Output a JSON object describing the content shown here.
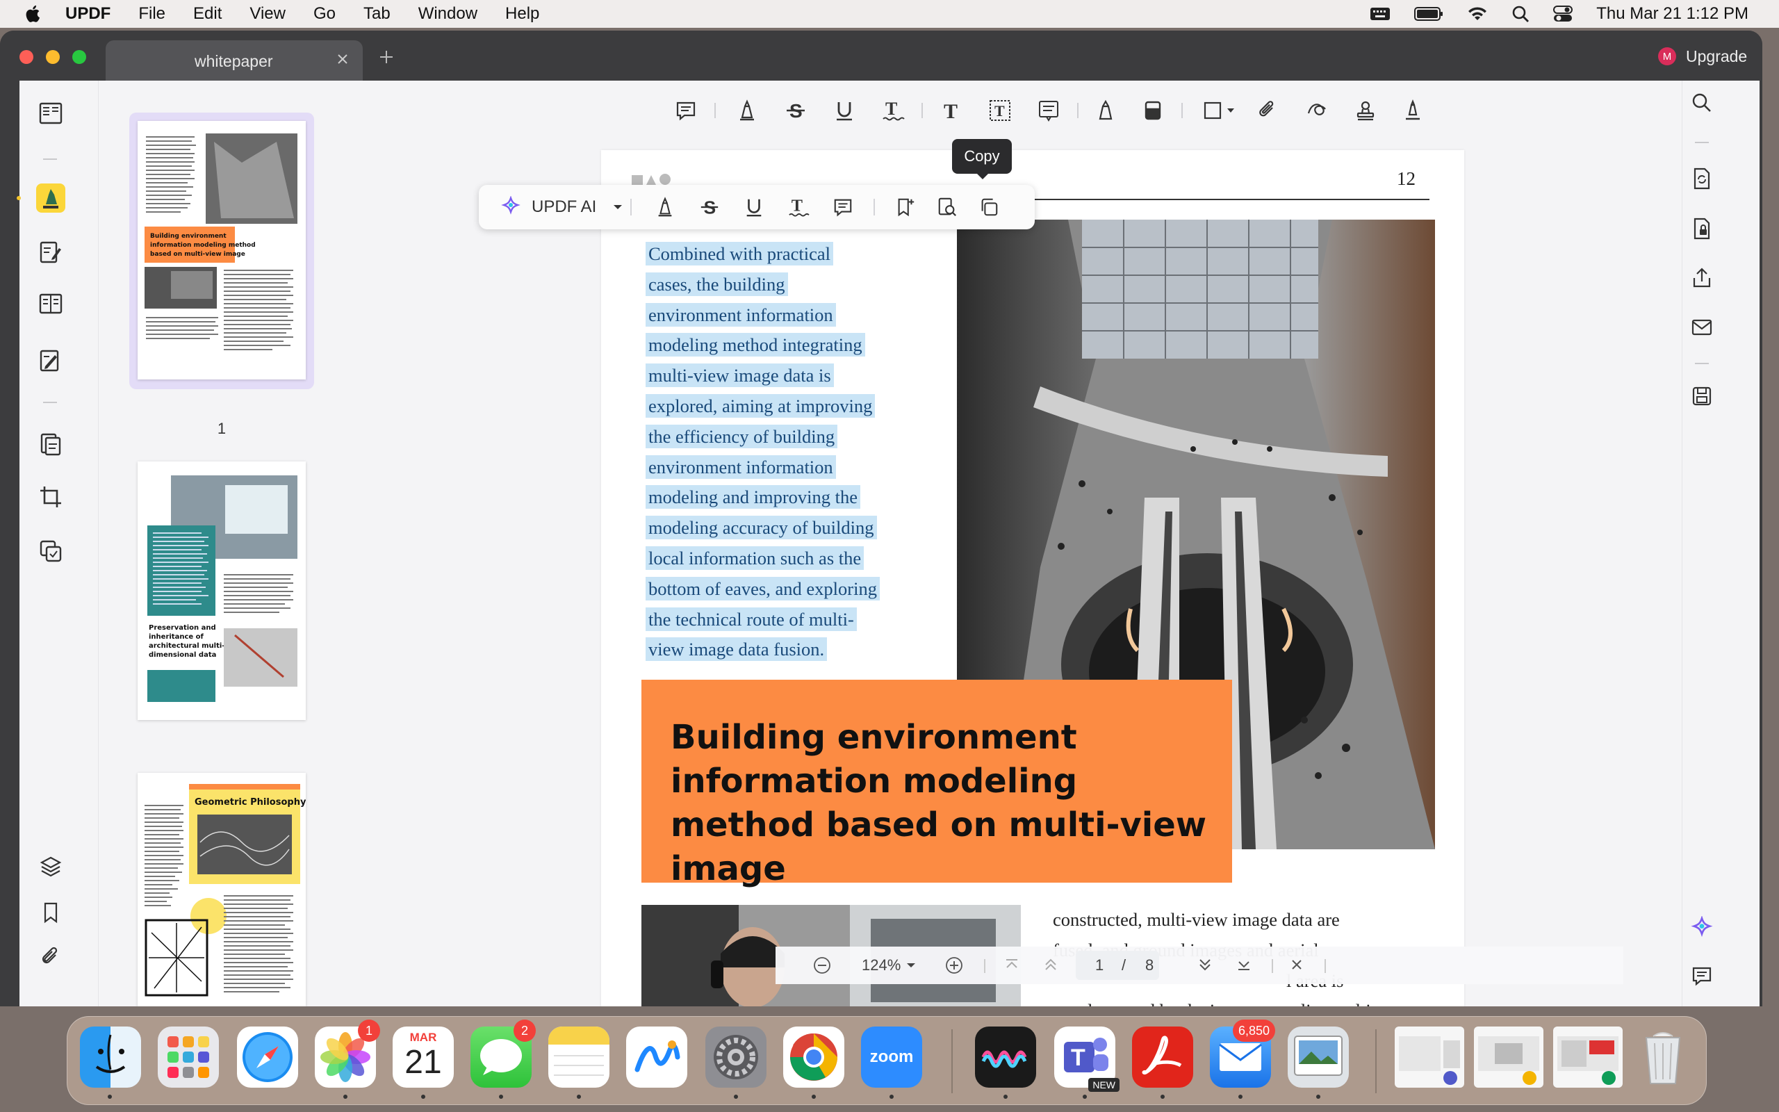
{
  "menubar": {
    "app_name": "UPDF",
    "menus": [
      "File",
      "Edit",
      "View",
      "Go",
      "Tab",
      "Window",
      "Help"
    ],
    "clock": "Thu Mar 21  1:12 PM"
  },
  "window": {
    "tab_title": "whitepaper",
    "upgrade_label": "Upgrade",
    "avatar_letter": "M"
  },
  "thumbnails": {
    "pages": [
      {
        "number": "1",
        "heading": "Building environment information modeling method based on multi-view image"
      },
      {
        "number": "2",
        "heading": "Preservation and inheritance of architectural multi-dimensional data"
      },
      {
        "number": "3",
        "heading": "Geometric Philosophy"
      }
    ]
  },
  "page": {
    "page_number": "12",
    "selected_text": [
      "Combined with practical",
      "cases, the building",
      "environment information",
      "modeling method integrating",
      "multi-view image data is",
      "explored, aiming at improving",
      "the efficiency of building",
      "environment information",
      "modeling and improving the",
      "modeling accuracy of building",
      "local information such as the",
      "bottom of eaves, and exploring",
      "the technical route of multi-",
      "view image data fusion."
    ],
    "heading": "Building environment information modeling method based on multi-view image",
    "body2": [
      "constructed, multi-view image data are",
      "fused, and ground images and aerial",
      "l area is",
      "supplemented by the image to realize multi-"
    ]
  },
  "float_toolbar": {
    "ai_label": "UPDF AI",
    "tooltip": "Copy"
  },
  "navbar": {
    "zoom": "124%",
    "current_page": "1",
    "separator": "/",
    "total_pages": "8"
  },
  "dock": {
    "calendar_month": "MAR",
    "calendar_day": "21",
    "photos_badge": "1",
    "messages_badge": "2",
    "mail_badge": "6,850",
    "zoom_label": "zoom",
    "teams_new": "NEW"
  },
  "colors": {
    "accent_orange": "#fc8b43",
    "selection": "#c9e4f6",
    "thumb_selected": "#e3dcf7",
    "window_dark": "#3c3c3e"
  }
}
